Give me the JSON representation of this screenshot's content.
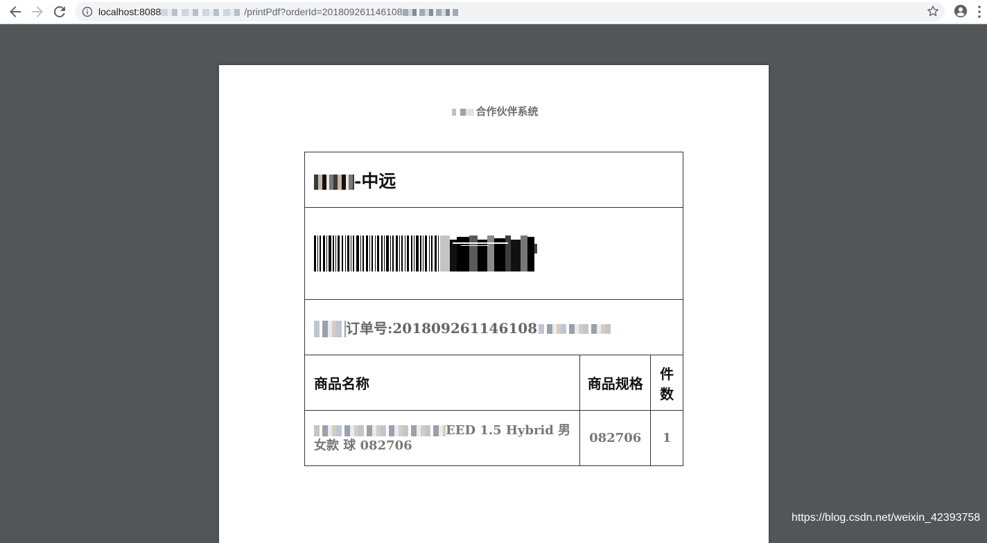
{
  "browser": {
    "url_host": "localhost:8088",
    "url_path": "/printPdf?orderId=201809261146108"
  },
  "document": {
    "system_title": "合作伙伴系统",
    "carrier_name": "-中远",
    "order_label": "订单号:201809261146108",
    "table_headers": [
      "商品名称",
      "商品规格",
      "件数"
    ],
    "items": [
      {
        "name": "EED 1.5 Hybrid 男",
        "name_line2": "女款 球 082706",
        "spec": "082706",
        "quantity": "1"
      }
    ]
  },
  "watermark": "https://blog.csdn.net/weixin_42393758"
}
